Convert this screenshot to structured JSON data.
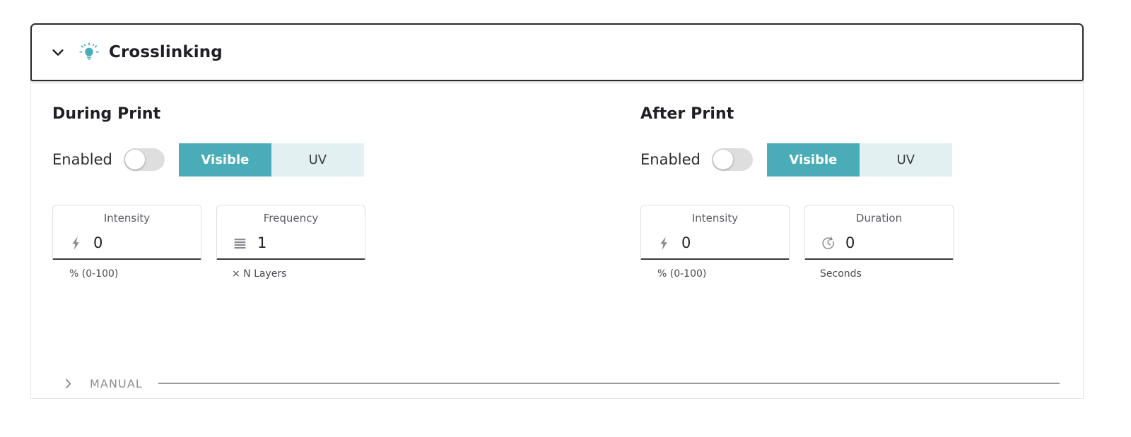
{
  "panel": {
    "title": "Crosslinking",
    "expand_icon": "chevron-down-icon",
    "status_icon": "lightbulb-icon",
    "accent_color": "#4aacb7",
    "accent_soft_color": "#e2f0f1"
  },
  "sections": [
    {
      "key": "during_print",
      "title": "During Print",
      "enabled": {
        "label": "Enabled",
        "value": "off"
      },
      "mode_options": [
        {
          "label": "Visible",
          "selected": true
        },
        {
          "label": "UV",
          "selected": false
        }
      ],
      "fields": [
        {
          "label": "Intensity",
          "value": "0",
          "icon": "lightning-bolt-icon",
          "helper": "% (0-100)"
        },
        {
          "label": "Frequency",
          "value": "1",
          "icon": "layers-icon",
          "helper": "× N Layers"
        }
      ]
    },
    {
      "key": "after_print",
      "title": "After Print",
      "enabled": {
        "label": "Enabled",
        "value": "off"
      },
      "mode_options": [
        {
          "label": "Visible",
          "selected": true
        },
        {
          "label": "UV",
          "selected": false
        }
      ],
      "fields": [
        {
          "label": "Intensity",
          "value": "0",
          "icon": "lightning-bolt-icon",
          "helper": "% (0-100)"
        },
        {
          "label": "Duration",
          "value": "0",
          "icon": "timer-icon",
          "helper": "Seconds"
        }
      ]
    }
  ],
  "manual_section": {
    "label": "MANUAL",
    "expand_icon": "chevron-right-icon",
    "expanded": false
  }
}
